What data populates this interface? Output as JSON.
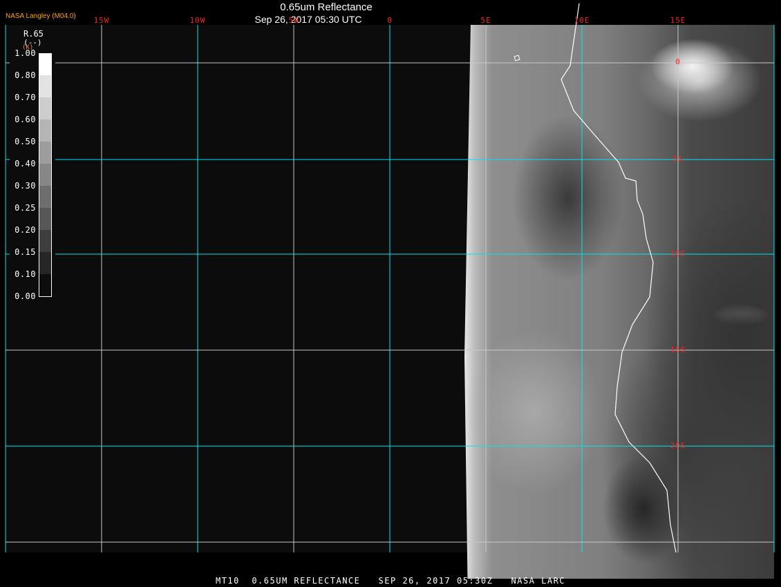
{
  "header": {
    "credit": "NASA Langley (M04.0)",
    "title": "0.65um Reflectance",
    "datetime": "Sep 26, 2017 05:30 UTC"
  },
  "footer": {
    "text": "MT10  0.65UM REFLECTANCE   SEP 26, 2017 05:30Z   NASA LARC"
  },
  "map": {
    "longitude_labels": [
      "15W",
      "10W",
      "5W",
      "0",
      "5E",
      "10E",
      "15E"
    ],
    "latitude_labels": [
      "0",
      "5S",
      "10S",
      "15S",
      "20S"
    ],
    "grid_color": "#00e5f0",
    "label_color": "#ff2020",
    "coastline_color": "#ffffff"
  },
  "colorbar": {
    "variable": "R.65",
    "units": "(--)",
    "unit_alt": "(K)",
    "labels": [
      "1.00",
      "0.80",
      "0.70",
      "0.60",
      "0.50",
      "0.40",
      "0.30",
      "0.25",
      "0.20",
      "0.15",
      "0.10",
      "0.00"
    ],
    "colors": [
      "#ffffff",
      "#e3e3e3",
      "#cdcdcd",
      "#b5b5b5",
      "#9d9d9d",
      "#878787",
      "#6e6e6e",
      "#575757",
      "#3e3e3e",
      "#262626",
      "#0d0d0d"
    ]
  }
}
